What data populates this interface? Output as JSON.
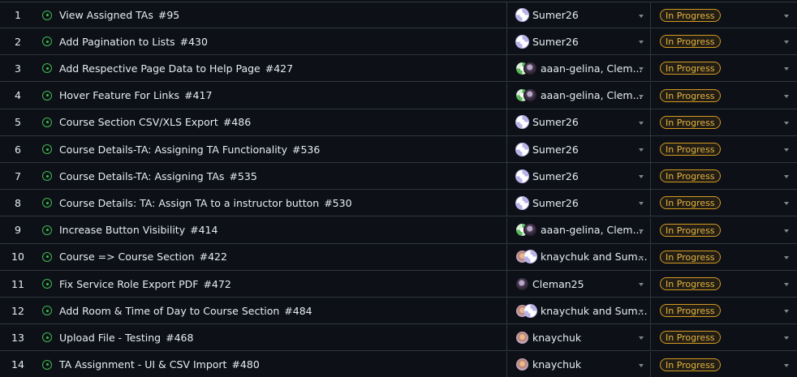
{
  "colors": {
    "background": "#0d1117",
    "border": "#30363d",
    "open_issue_icon": "#3fb950",
    "status_badge": "#d29922"
  },
  "rows": [
    {
      "num": "1",
      "title": "View Assigned TAs",
      "issue": "#95",
      "avatars": [
        "sumer"
      ],
      "assignee": "Sumer26",
      "status": "In Progress"
    },
    {
      "num": "2",
      "title": "Add Pagination to Lists",
      "issue": "#430",
      "avatars": [
        "sumer"
      ],
      "assignee": "Sumer26",
      "status": "In Progress"
    },
    {
      "num": "3",
      "title": "Add Respective Page Data to Help Page",
      "issue": "#427",
      "avatars": [
        "aaan",
        "cleman"
      ],
      "assignee": "aaan-gelina, Clem...",
      "status": "In Progress"
    },
    {
      "num": "4",
      "title": "Hover Feature For Links",
      "issue": "#417",
      "avatars": [
        "aaan",
        "cleman"
      ],
      "assignee": "aaan-gelina, Clem...",
      "status": "In Progress"
    },
    {
      "num": "5",
      "title": "Course Section CSV/XLS Export",
      "issue": "#486",
      "avatars": [
        "sumer"
      ],
      "assignee": "Sumer26",
      "status": "In Progress"
    },
    {
      "num": "6",
      "title": "Course Details-TA: Assigning TA Functionality",
      "issue": "#536",
      "avatars": [
        "sumer"
      ],
      "assignee": "Sumer26",
      "status": "In Progress"
    },
    {
      "num": "7",
      "title": "Course Details-TA: Assigning TAs",
      "issue": "#535",
      "avatars": [
        "sumer"
      ],
      "assignee": "Sumer26",
      "status": "In Progress"
    },
    {
      "num": "8",
      "title": "Course Details: TA: Assign TA to a instructor button",
      "issue": "#530",
      "avatars": [
        "sumer"
      ],
      "assignee": "Sumer26",
      "status": "In Progress"
    },
    {
      "num": "9",
      "title": "Increase Button Visibility",
      "issue": "#414",
      "avatars": [
        "aaan",
        "cleman"
      ],
      "assignee": "aaan-gelina, Clem...",
      "status": "In Progress"
    },
    {
      "num": "10",
      "title": "Course => Course Section",
      "issue": "#422",
      "avatars": [
        "knay",
        "sumer"
      ],
      "assignee": "knaychuk and Sum...",
      "status": "In Progress"
    },
    {
      "num": "11",
      "title": "Fix Service Role Export PDF",
      "issue": "#472",
      "avatars": [
        "cleman"
      ],
      "assignee": "Cleman25",
      "status": "In Progress"
    },
    {
      "num": "12",
      "title": "Add Room & Time of Day to Course Section",
      "issue": "#484",
      "avatars": [
        "knay",
        "sumer"
      ],
      "assignee": "knaychuk and Sum...",
      "status": "In Progress"
    },
    {
      "num": "13",
      "title": "Upload File - Testing",
      "issue": "#468",
      "avatars": [
        "knay"
      ],
      "assignee": "knaychuk",
      "status": "In Progress"
    },
    {
      "num": "14",
      "title": "TA Assignment - UI & CSV Import",
      "issue": "#480",
      "avatars": [
        "knay"
      ],
      "assignee": "knaychuk",
      "status": "In Progress"
    }
  ]
}
